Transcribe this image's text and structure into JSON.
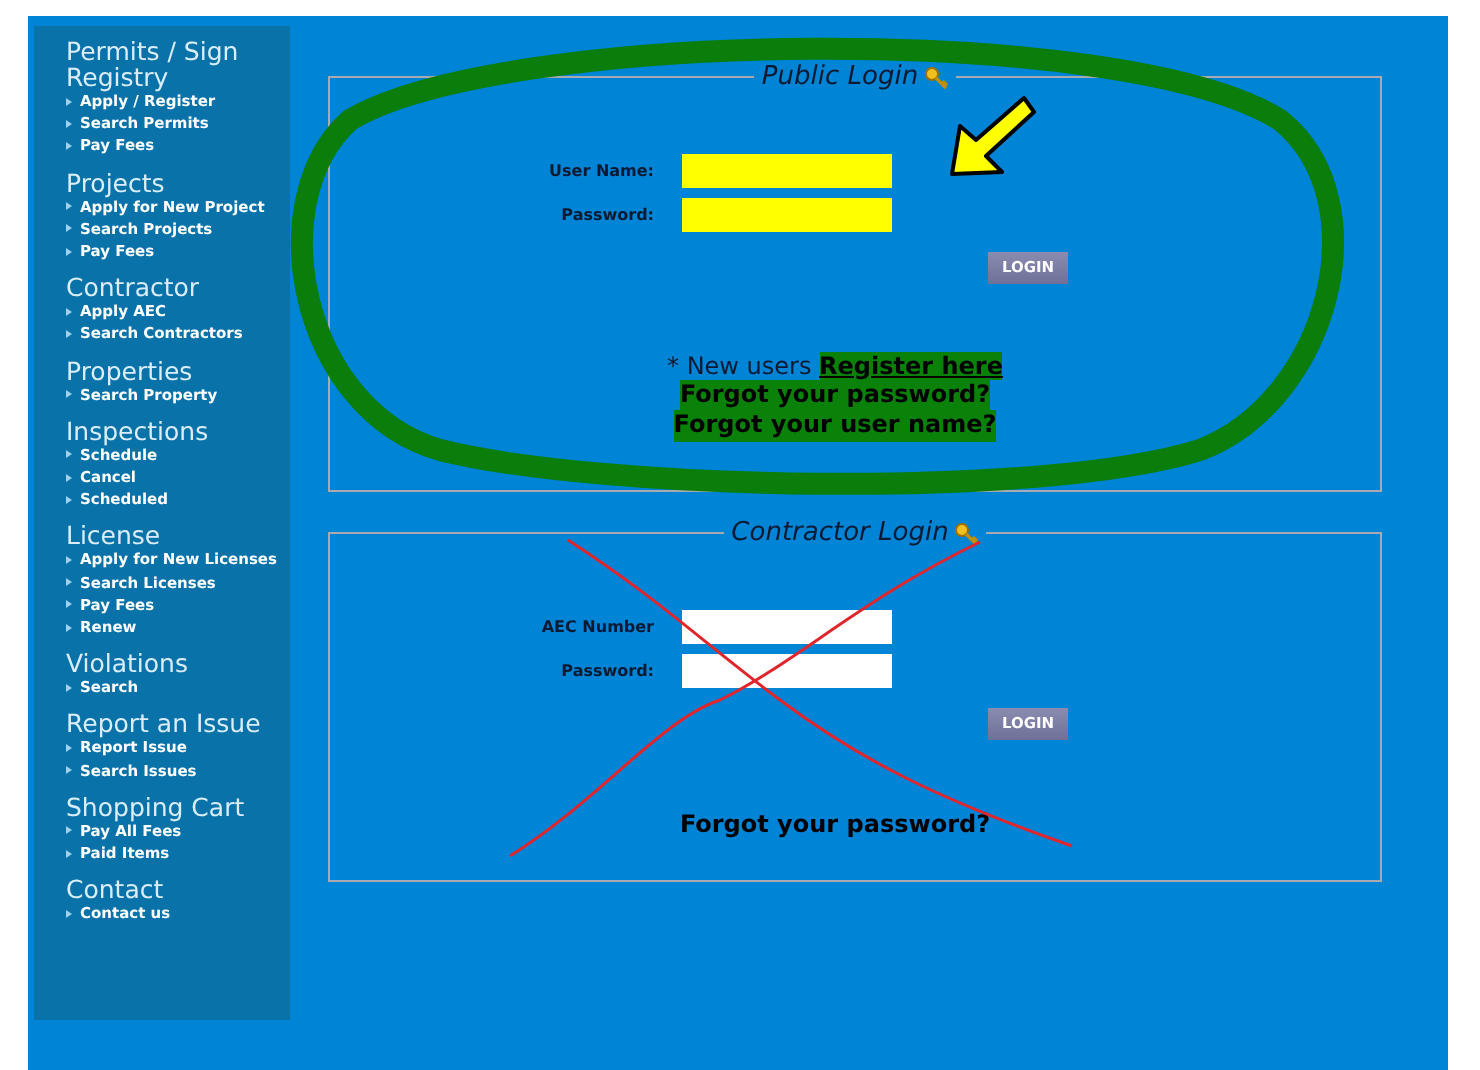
{
  "sidebar": {
    "sections": [
      {
        "heading": "Permits / Sign Registry",
        "links": [
          "Apply / Register",
          "Search Permits",
          "Pay Fees"
        ]
      },
      {
        "heading": "Projects",
        "links": [
          "Apply for New Project",
          "Search Projects",
          "Pay Fees"
        ]
      },
      {
        "heading": "Contractor",
        "links": [
          "Apply AEC",
          "Search Contractors"
        ]
      },
      {
        "heading": "Properties",
        "links": [
          "Search Property"
        ]
      },
      {
        "heading": "Inspections",
        "links": [
          "Schedule",
          "Cancel",
          "Scheduled"
        ]
      },
      {
        "heading": "License",
        "links": [
          "Apply for New Licenses",
          "Search Licenses",
          "Pay Fees",
          "Renew"
        ]
      },
      {
        "heading": "Violations",
        "links": [
          "Search"
        ]
      },
      {
        "heading": "Report an Issue",
        "links": [
          "Report Issue",
          "Search Issues"
        ]
      },
      {
        "heading": "Shopping Cart",
        "links": [
          "Pay All Fees",
          "Paid Items"
        ]
      },
      {
        "heading": "Contact",
        "links": [
          "Contact us"
        ]
      }
    ]
  },
  "public_login": {
    "legend": "Public Login",
    "fields": [
      {
        "label": "User Name:",
        "highlighted": true
      },
      {
        "label": "Password:",
        "highlighted": true
      }
    ],
    "button": "LOGIN",
    "new_users_text": "* New users",
    "register_link": {
      "text": "Register here",
      "highlighted": true
    },
    "links": [
      {
        "text": "Forgot your password?",
        "highlighted": true
      },
      {
        "text": "Forgot your user name?",
        "highlighted": true
      }
    ]
  },
  "contractor_login": {
    "legend": "Contractor Login",
    "fields": [
      {
        "label": "AEC Number",
        "highlighted": false
      },
      {
        "label": "Password:",
        "highlighted": false
      }
    ],
    "button": "LOGIN",
    "links": [
      {
        "text": "Forgot your password?",
        "highlighted": false
      }
    ]
  },
  "annotations": [
    {
      "kind": "ellipse"
    },
    {
      "kind": "arrow"
    },
    {
      "kind": "cross"
    }
  ]
}
